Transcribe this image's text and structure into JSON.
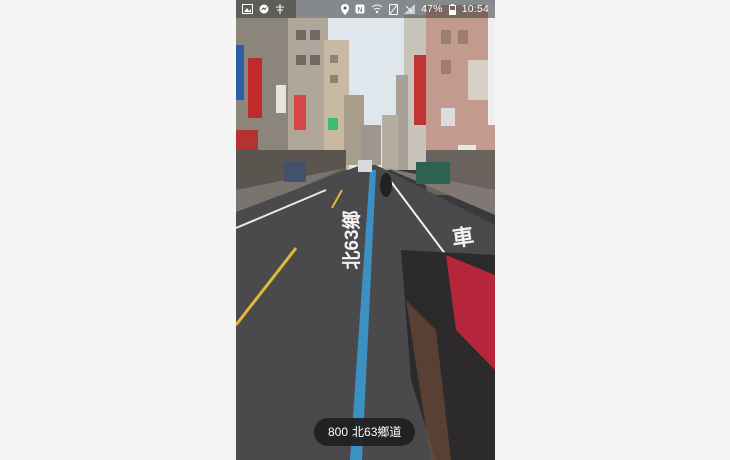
{
  "status_bar": {
    "left_icons": [
      "image-icon",
      "messenger-icon",
      "tree-icon"
    ],
    "right_icons": [
      "location-icon",
      "nfc-icon",
      "wifi-icon",
      "nosim-icon",
      "signal-icon",
      "battery-icon"
    ],
    "battery_percent": "47%",
    "time": "10:54"
  },
  "street_view": {
    "road_marking_text": "北63鄉",
    "lane_marking_text": "車",
    "location_label": {
      "number": "800",
      "road": "北63鄉道"
    }
  },
  "colors": {
    "accent_blue_route": "#3d90c2",
    "sky": "#dfe6ec",
    "road": "#4a4a4c",
    "pill": "#1e1e1e"
  }
}
